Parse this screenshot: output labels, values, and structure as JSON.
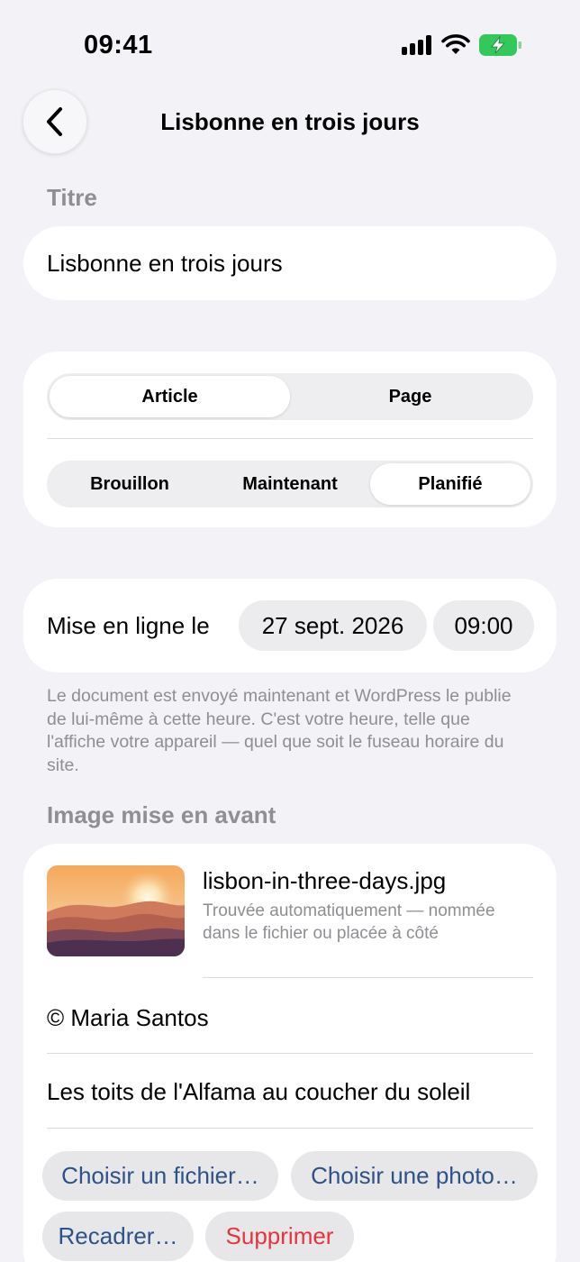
{
  "status_bar": {
    "time": "09:41",
    "icons": [
      "signal-icon",
      "wifi-icon",
      "battery-charging-icon"
    ],
    "battery_color": "#34c759"
  },
  "nav": {
    "back_icon": "chevron-left-icon",
    "title": "Lisbonne en trois jours"
  },
  "title_section": {
    "label": "Titre",
    "value": "Lisbonne en trois jours"
  },
  "post_type": {
    "options": [
      "Article",
      "Page"
    ],
    "selected": "Article"
  },
  "publish_mode": {
    "options": [
      "Brouillon",
      "Maintenant",
      "Planifié"
    ],
    "selected": "Planifié"
  },
  "schedule": {
    "label": "Mise en ligne le",
    "date": "27 sept. 2026",
    "time": "09:00",
    "footnote": "Le document est envoyé maintenant et WordPress le publie de lui-même à cette heure. C'est votre heure, telle que l'affiche votre appareil — quel que soit le fuseau horaire du site."
  },
  "featured_image": {
    "label": "Image mise en avant",
    "file_name": "lisbon-in-three-days.jpg",
    "file_note": "Trouvée automatiquement — nommée dans le fichier ou placée à côté",
    "credit": "© Maria Santos",
    "caption": "Les toits de l'Alfama au coucher du soleil",
    "actions": {
      "choose_file": "Choisir un fichier…",
      "choose_photo": "Choisir une photo…",
      "crop": "Recadrer…",
      "delete": "Supprimer"
    }
  },
  "colors": {
    "background": "#f2f2f7",
    "card": "#ffffff",
    "secondary_text": "#8e8e93",
    "action_text": "#2d5288",
    "destructive": "#e5343c"
  }
}
